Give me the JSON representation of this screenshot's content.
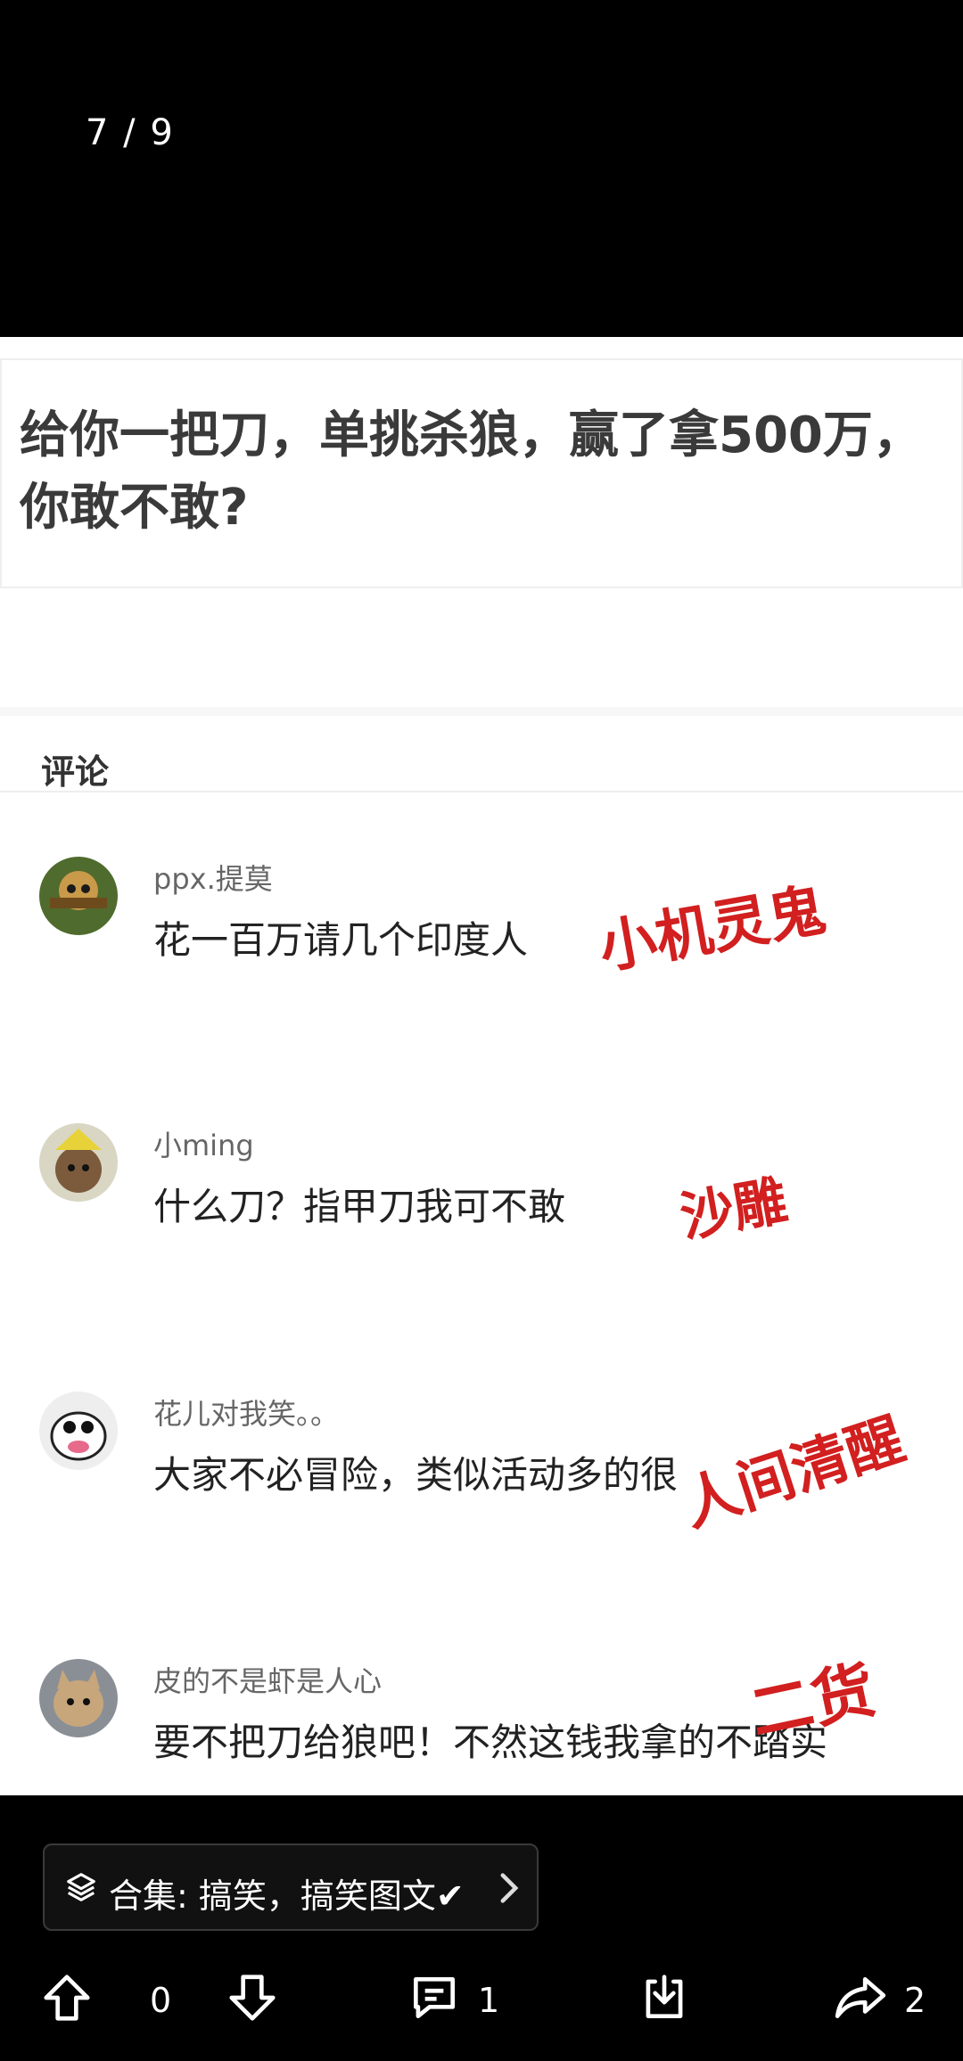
{
  "viewer": {
    "counter": "7 / 9"
  },
  "post": {
    "question": "给你一把刀，单挑杀狼，赢了拿500万，你敢不敢?",
    "comments_title": "评论",
    "comments": [
      {
        "user": "ppx.提莫",
        "text": "花一百万请几个印度人",
        "tag": "小机灵鬼"
      },
      {
        "user": "小ming",
        "text": "什么刀？指甲刀我可不敢",
        "tag": "沙雕"
      },
      {
        "user": "花儿对我笑。。",
        "text": "大家不必冒险，类似活动多的很",
        "tag": "人间清醒"
      },
      {
        "user": "皮的不是虾是人心",
        "text": "要不把刀给狼吧！不然这钱我拿的不踏实",
        "tag": "二货"
      }
    ]
  },
  "collection": {
    "label": "合集: 搞笑，搞笑图文✔"
  },
  "actions": {
    "upvote_count": "0",
    "comment_count": "1",
    "share_count": "2"
  },
  "colors": {
    "tag_red": "#d21f1f"
  }
}
